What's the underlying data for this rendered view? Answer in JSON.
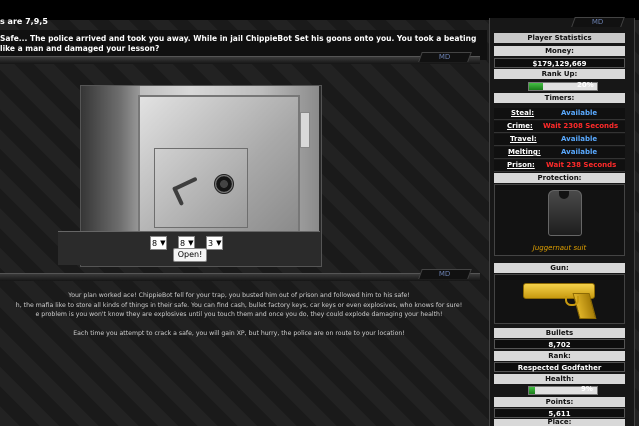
{
  "notice": {
    "line1": "s are 7,9,5",
    "message": "Safe... The police arrived and took you away. While in jail ChippieBot Set his goons onto you. You took a beating like a man and damaged your lesson?"
  },
  "tabs": {
    "md_label": "MD"
  },
  "safe": {
    "selects": [
      {
        "value": "8"
      },
      {
        "value": "8"
      },
      {
        "value": "3"
      }
    ],
    "open_label": "Open!"
  },
  "result": {
    "lines": [
      "Your plan worked ace! ChippieBot fell for your trap, you busted him out of prison and followed him to his safe!",
      "h, the mafia like to store all kinds of things in their safe. You can find cash, bullet factory keys, car keys or even explosives, who knows for sure!",
      "e problem is you won't know they are explosives until you touch them and once you do, they could explode damaging your health!",
      "",
      "Each time you attempt to crack a safe, you will gain XP, but hurry, the police are on route to your location!"
    ]
  },
  "sidebar": {
    "title": "Player Statistics",
    "money_label": "Money:",
    "money_value": "$179,129,669",
    "rankup_label": "Rank Up:",
    "rankup_percent": "20%",
    "rankup_fraction": 0.2,
    "timers_label": "Timers:",
    "timers": [
      {
        "label": "Steal:",
        "status": "Available",
        "kind": "available"
      },
      {
        "label": "Crime:",
        "status": "Wait 2308 Seconds",
        "kind": "wait"
      },
      {
        "label": "Travel:",
        "status": "Available",
        "kind": "available"
      },
      {
        "label": "Melting:",
        "status": "Available",
        "kind": "available"
      },
      {
        "label": "Prison:",
        "status": "Wait 238 Seconds",
        "kind": "wait"
      }
    ],
    "protection_label": "Protection:",
    "protection_item": "Juggernaut suit",
    "gun_label": "Gun:",
    "bullets_label": "Bullets",
    "bullets_value": "8,702",
    "rank_label": "Rank:",
    "rank_value": "Respected Godfather",
    "health_label": "Health:",
    "health_percent": "9%",
    "health_fraction": 0.09,
    "points_label": "Points:",
    "points_value": "5,611",
    "place_label": "Place:"
  },
  "colors": {
    "available": "#5aaaff",
    "wait": "#ff2a2a",
    "bar_fill": "#2ea82e",
    "gold": "#e0a000"
  }
}
